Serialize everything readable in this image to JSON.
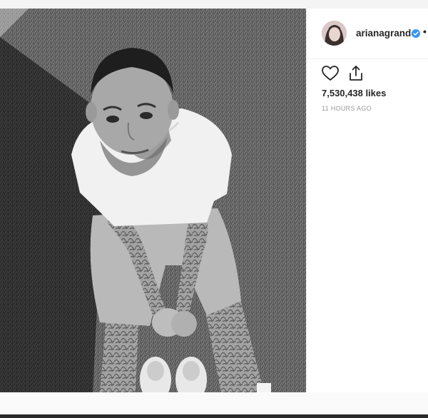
{
  "post": {
    "username": "arianagrande",
    "separator_dot": "•",
    "likes_text": "7,530,438 likes",
    "timestamp": "11 HOURS AGO",
    "verified": true
  },
  "icons": {
    "like": "heart-outline-icon",
    "share": "share-upload-icon",
    "verified": "verified-badge-icon"
  },
  "colors": {
    "verified_blue": "#3897f0",
    "text_primary": "#262626",
    "text_muted": "#999999"
  }
}
